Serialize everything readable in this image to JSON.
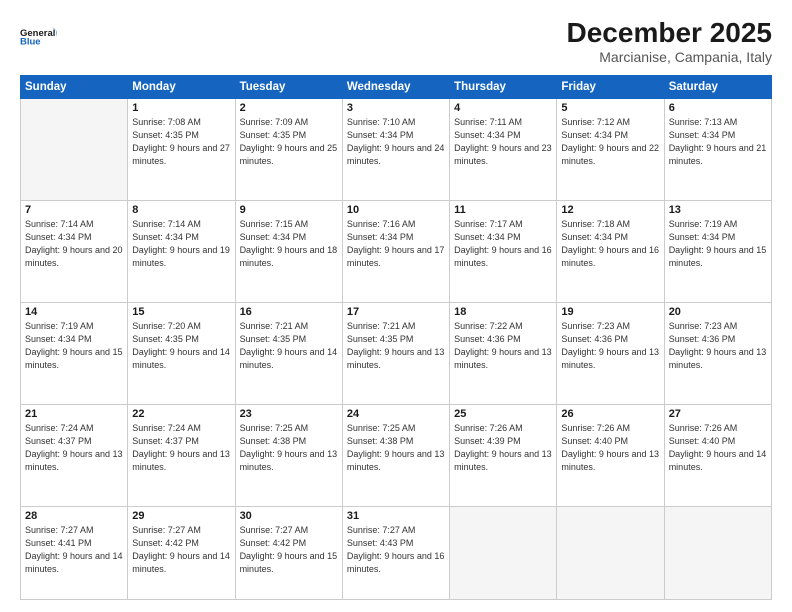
{
  "logo": {
    "line1": "General",
    "line2": "Blue"
  },
  "title": "December 2025",
  "location": "Marcianise, Campania, Italy",
  "days_of_week": [
    "Sunday",
    "Monday",
    "Tuesday",
    "Wednesday",
    "Thursday",
    "Friday",
    "Saturday"
  ],
  "weeks": [
    [
      {
        "num": "",
        "empty": true
      },
      {
        "num": "1",
        "sunrise": "7:08 AM",
        "sunset": "4:35 PM",
        "daylight": "9 hours and 27 minutes."
      },
      {
        "num": "2",
        "sunrise": "7:09 AM",
        "sunset": "4:35 PM",
        "daylight": "9 hours and 25 minutes."
      },
      {
        "num": "3",
        "sunrise": "7:10 AM",
        "sunset": "4:34 PM",
        "daylight": "9 hours and 24 minutes."
      },
      {
        "num": "4",
        "sunrise": "7:11 AM",
        "sunset": "4:34 PM",
        "daylight": "9 hours and 23 minutes."
      },
      {
        "num": "5",
        "sunrise": "7:12 AM",
        "sunset": "4:34 PM",
        "daylight": "9 hours and 22 minutes."
      },
      {
        "num": "6",
        "sunrise": "7:13 AM",
        "sunset": "4:34 PM",
        "daylight": "9 hours and 21 minutes."
      }
    ],
    [
      {
        "num": "7",
        "sunrise": "7:14 AM",
        "sunset": "4:34 PM",
        "daylight": "9 hours and 20 minutes."
      },
      {
        "num": "8",
        "sunrise": "7:14 AM",
        "sunset": "4:34 PM",
        "daylight": "9 hours and 19 minutes."
      },
      {
        "num": "9",
        "sunrise": "7:15 AM",
        "sunset": "4:34 PM",
        "daylight": "9 hours and 18 minutes."
      },
      {
        "num": "10",
        "sunrise": "7:16 AM",
        "sunset": "4:34 PM",
        "daylight": "9 hours and 17 minutes."
      },
      {
        "num": "11",
        "sunrise": "7:17 AM",
        "sunset": "4:34 PM",
        "daylight": "9 hours and 16 minutes."
      },
      {
        "num": "12",
        "sunrise": "7:18 AM",
        "sunset": "4:34 PM",
        "daylight": "9 hours and 16 minutes."
      },
      {
        "num": "13",
        "sunrise": "7:19 AM",
        "sunset": "4:34 PM",
        "daylight": "9 hours and 15 minutes."
      }
    ],
    [
      {
        "num": "14",
        "sunrise": "7:19 AM",
        "sunset": "4:34 PM",
        "daylight": "9 hours and 15 minutes."
      },
      {
        "num": "15",
        "sunrise": "7:20 AM",
        "sunset": "4:35 PM",
        "daylight": "9 hours and 14 minutes."
      },
      {
        "num": "16",
        "sunrise": "7:21 AM",
        "sunset": "4:35 PM",
        "daylight": "9 hours and 14 minutes."
      },
      {
        "num": "17",
        "sunrise": "7:21 AM",
        "sunset": "4:35 PM",
        "daylight": "9 hours and 13 minutes."
      },
      {
        "num": "18",
        "sunrise": "7:22 AM",
        "sunset": "4:36 PM",
        "daylight": "9 hours and 13 minutes."
      },
      {
        "num": "19",
        "sunrise": "7:23 AM",
        "sunset": "4:36 PM",
        "daylight": "9 hours and 13 minutes."
      },
      {
        "num": "20",
        "sunrise": "7:23 AM",
        "sunset": "4:36 PM",
        "daylight": "9 hours and 13 minutes."
      }
    ],
    [
      {
        "num": "21",
        "sunrise": "7:24 AM",
        "sunset": "4:37 PM",
        "daylight": "9 hours and 13 minutes."
      },
      {
        "num": "22",
        "sunrise": "7:24 AM",
        "sunset": "4:37 PM",
        "daylight": "9 hours and 13 minutes."
      },
      {
        "num": "23",
        "sunrise": "7:25 AM",
        "sunset": "4:38 PM",
        "daylight": "9 hours and 13 minutes."
      },
      {
        "num": "24",
        "sunrise": "7:25 AM",
        "sunset": "4:38 PM",
        "daylight": "9 hours and 13 minutes."
      },
      {
        "num": "25",
        "sunrise": "7:26 AM",
        "sunset": "4:39 PM",
        "daylight": "9 hours and 13 minutes."
      },
      {
        "num": "26",
        "sunrise": "7:26 AM",
        "sunset": "4:40 PM",
        "daylight": "9 hours and 13 minutes."
      },
      {
        "num": "27",
        "sunrise": "7:26 AM",
        "sunset": "4:40 PM",
        "daylight": "9 hours and 14 minutes."
      }
    ],
    [
      {
        "num": "28",
        "sunrise": "7:27 AM",
        "sunset": "4:41 PM",
        "daylight": "9 hours and 14 minutes."
      },
      {
        "num": "29",
        "sunrise": "7:27 AM",
        "sunset": "4:42 PM",
        "daylight": "9 hours and 14 minutes."
      },
      {
        "num": "30",
        "sunrise": "7:27 AM",
        "sunset": "4:42 PM",
        "daylight": "9 hours and 15 minutes."
      },
      {
        "num": "31",
        "sunrise": "7:27 AM",
        "sunset": "4:43 PM",
        "daylight": "9 hours and 16 minutes."
      },
      {
        "num": "",
        "empty": true
      },
      {
        "num": "",
        "empty": true
      },
      {
        "num": "",
        "empty": true
      }
    ]
  ]
}
